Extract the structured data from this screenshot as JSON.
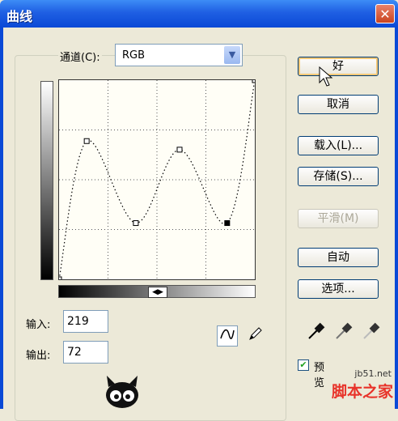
{
  "window": {
    "title": "曲线",
    "close_glyph": "✕"
  },
  "channel": {
    "label": "通道(C):",
    "value": "RGB"
  },
  "curve": {
    "points": [
      {
        "input": 0,
        "output": 0
      },
      {
        "input": 36,
        "output": 177
      },
      {
        "input": 100,
        "output": 72
      },
      {
        "input": 157,
        "output": 166
      },
      {
        "input": 219,
        "output": 72
      },
      {
        "input": 255,
        "output": 255
      }
    ],
    "selected_point_index": 4
  },
  "readout": {
    "input_label": "输入:",
    "input_value": "219",
    "output_label": "输出:",
    "output_value": "72"
  },
  "buttons": {
    "ok": "好",
    "cancel": "取消",
    "load": "载入(L)...",
    "save": "存储(S)...",
    "smooth": "平滑(M)",
    "auto": "自动",
    "options": "选项..."
  },
  "preview": {
    "label": "预览",
    "checked": true
  },
  "watermark": {
    "site": "jb51.net",
    "brand": "脚本之家"
  },
  "icons": {
    "curve_tool": "curve-icon",
    "pencil_tool": "pencil-icon",
    "droppers": [
      "black-eyedropper-icon",
      "gray-eyedropper-icon",
      "white-eyedropper-icon"
    ]
  },
  "colors": {
    "titlebar": "#0a49d6",
    "close": "#c9441f",
    "brand": "#e8332a"
  }
}
